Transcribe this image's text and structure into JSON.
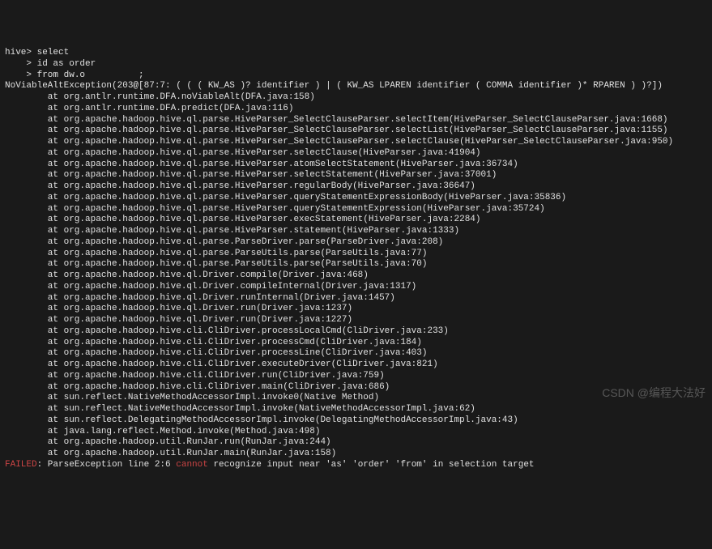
{
  "prompt": {
    "line1_prefix": "hive> ",
    "line1_cmd": "select",
    "line2_prefix": "    > ",
    "line2_cmd": "id as order",
    "line3_prefix": "    > ",
    "line3_cmd1": "from dw.o",
    "line3_cmd2": "          ;"
  },
  "exception_header": "NoViableAltException(203@[87:7: ( ( ( KW_AS )? identifier ) | ( KW_AS LPAREN identifier ( COMMA identifier )* RPAREN ) )?])",
  "trace_at": "at ",
  "trace": [
    "org.antlr.runtime.DFA.noViableAlt(DFA.java:158)",
    "org.antlr.runtime.DFA.predict(DFA.java:116)",
    "org.apache.hadoop.hive.ql.parse.HiveParser_SelectClauseParser.selectItem(HiveParser_SelectClauseParser.java:1668)",
    "org.apache.hadoop.hive.ql.parse.HiveParser_SelectClauseParser.selectList(HiveParser_SelectClauseParser.java:1155)",
    "org.apache.hadoop.hive.ql.parse.HiveParser_SelectClauseParser.selectClause(HiveParser_SelectClauseParser.java:950)",
    "org.apache.hadoop.hive.ql.parse.HiveParser.selectClause(HiveParser.java:41904)",
    "org.apache.hadoop.hive.ql.parse.HiveParser.atomSelectStatement(HiveParser.java:36734)",
    "org.apache.hadoop.hive.ql.parse.HiveParser.selectStatement(HiveParser.java:37001)",
    "org.apache.hadoop.hive.ql.parse.HiveParser.regularBody(HiveParser.java:36647)",
    "org.apache.hadoop.hive.ql.parse.HiveParser.queryStatementExpressionBody(HiveParser.java:35836)",
    "org.apache.hadoop.hive.ql.parse.HiveParser.queryStatementExpression(HiveParser.java:35724)",
    "org.apache.hadoop.hive.ql.parse.HiveParser.execStatement(HiveParser.java:2284)",
    "org.apache.hadoop.hive.ql.parse.HiveParser.statement(HiveParser.java:1333)",
    "org.apache.hadoop.hive.ql.parse.ParseDriver.parse(ParseDriver.java:208)",
    "org.apache.hadoop.hive.ql.parse.ParseUtils.parse(ParseUtils.java:77)",
    "org.apache.hadoop.hive.ql.parse.ParseUtils.parse(ParseUtils.java:70)",
    "org.apache.hadoop.hive.ql.Driver.compile(Driver.java:468)",
    "org.apache.hadoop.hive.ql.Driver.compileInternal(Driver.java:1317)",
    "org.apache.hadoop.hive.ql.Driver.runInternal(Driver.java:1457)",
    "org.apache.hadoop.hive.ql.Driver.run(Driver.java:1237)",
    "org.apache.hadoop.hive.ql.Driver.run(Driver.java:1227)",
    "org.apache.hadoop.hive.cli.CliDriver.processLocalCmd(CliDriver.java:233)",
    "org.apache.hadoop.hive.cli.CliDriver.processCmd(CliDriver.java:184)",
    "org.apache.hadoop.hive.cli.CliDriver.processLine(CliDriver.java:403)",
    "org.apache.hadoop.hive.cli.CliDriver.executeDriver(CliDriver.java:821)",
    "org.apache.hadoop.hive.cli.CliDriver.run(CliDriver.java:759)",
    "org.apache.hadoop.hive.cli.CliDriver.main(CliDriver.java:686)",
    "sun.reflect.NativeMethodAccessorImpl.invoke0(Native Method)",
    "sun.reflect.NativeMethodAccessorImpl.invoke(NativeMethodAccessorImpl.java:62)",
    "sun.reflect.DelegatingMethodAccessorImpl.invoke(DelegatingMethodAccessorImpl.java:43)",
    "java.lang.reflect.Method.invoke(Method.java:498)",
    "org.apache.hadoop.util.RunJar.run(RunJar.java:244)",
    "org.apache.hadoop.util.RunJar.main(RunJar.java:158)"
  ],
  "failed": {
    "tag": "FAILED",
    "sep1": ": ParseException line 2:6 ",
    "cannot": "cannot",
    "rest": " recognize input near 'as' 'order' 'from' in selection target"
  },
  "watermark": "CSDN @编程大法好"
}
